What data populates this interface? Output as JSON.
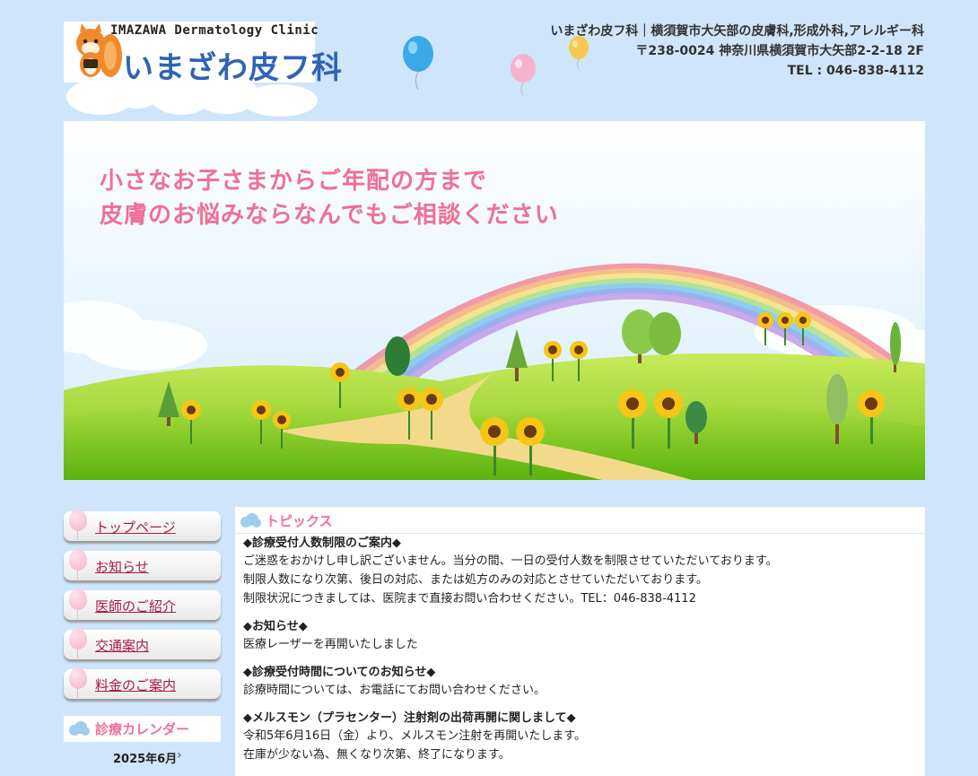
{
  "header": {
    "logo_en": "IMAZAWA Dermatology Clinic",
    "logo_jp": "いまざわ皮フ科",
    "clinic_line1": "いまざわ皮フ科｜横須賀市大矢部の皮膚科,形成外科,アレルギー科",
    "clinic_line2": "〒238-0024 神奈川県横須賀市大矢部2-2-18 2F",
    "clinic_line3": "TEL : 046-838-4112"
  },
  "hero": {
    "line1": "小さなお子さまからご年配の方まで",
    "line2": "皮膚のお悩みならなんでもご相談ください"
  },
  "sidebar": {
    "items": [
      {
        "label": "トップページ"
      },
      {
        "label": "お知らせ"
      },
      {
        "label": "医師のご紹介"
      },
      {
        "label": "交通案内"
      },
      {
        "label": "料金のご案内"
      }
    ],
    "calendar_title": "診療カレンダー",
    "calendar_month": "2025年6月",
    "calendar_next": "›"
  },
  "main": {
    "section_title": "トピックス",
    "topics": [
      {
        "title": "◆診療受付人数制限のご案内◆",
        "lines": [
          "ご迷惑をおかけし申し訳ございません。当分の間、一日の受付人数を制限させていただいております。",
          "制限人数になり次第、後日の対応、または処方のみの対応とさせていただいております。",
          "制限状況につきましては、医院まで直接お問い合わせください。TEL：046-838-4112"
        ]
      },
      {
        "title": "◆お知らせ◆",
        "lines": [
          "医療レーザーを再開いたしました"
        ]
      },
      {
        "title": "◆診療受付時間についてのお知らせ◆",
        "lines": [
          "診療時間については、お電話にてお問い合わせください。"
        ]
      },
      {
        "title": "◆メルスモン（プラセンター）注射剤の出荷再開に関しまして◆",
        "lines": [
          "令和5年6月16日（金）より、メルスモン注射を再開いたします。",
          "在庫が少ない為、無くなり次第、終了になります。"
        ]
      }
    ]
  }
}
